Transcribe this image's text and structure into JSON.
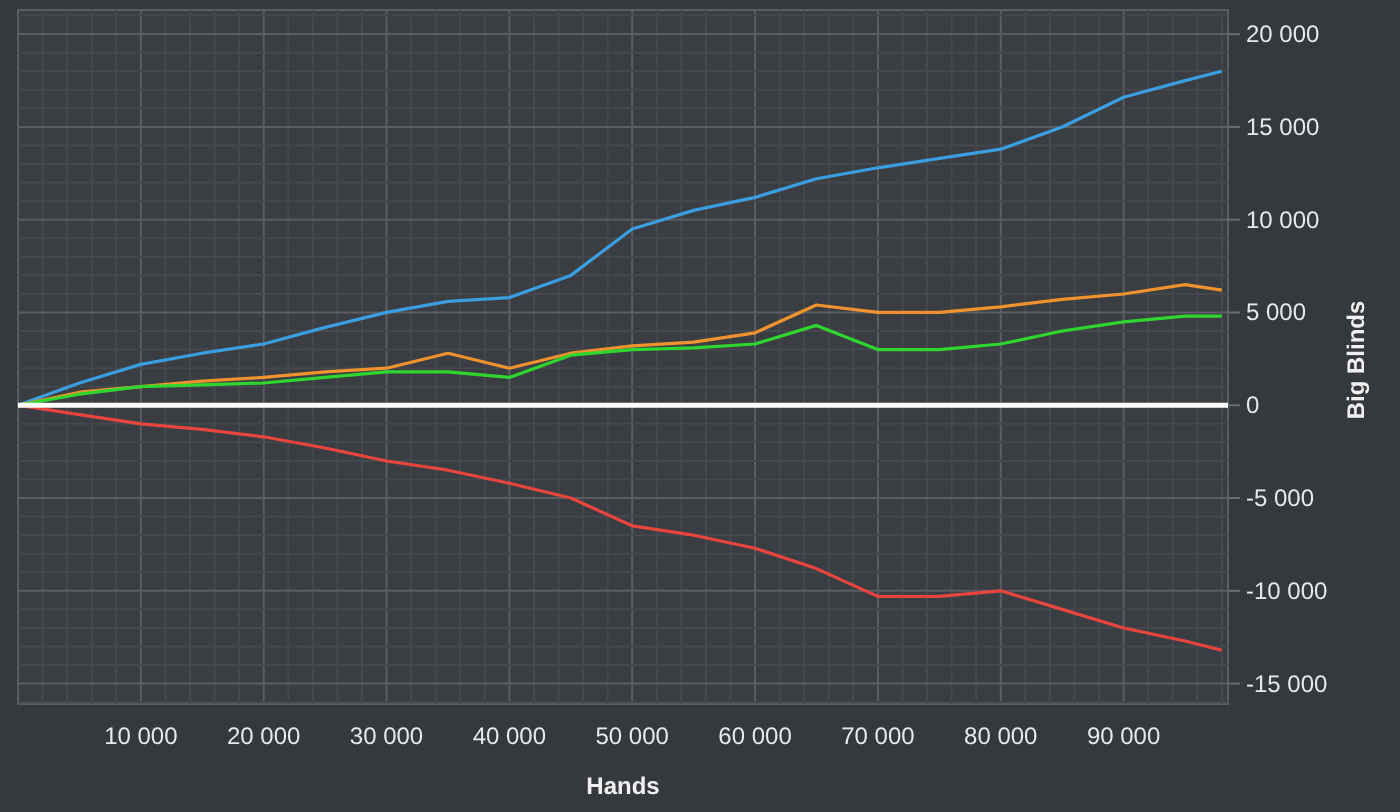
{
  "chart": {
    "chart_data": {
      "type": "line",
      "xlabel": "Hands",
      "ylabel": "Big Blinds",
      "x": [
        0,
        5000,
        10000,
        15000,
        20000,
        25000,
        30000,
        35000,
        40000,
        45000,
        50000,
        55000,
        60000,
        65000,
        70000,
        75000,
        80000,
        85000,
        90000,
        95000,
        98000
      ],
      "series": [
        {
          "color": "#3a9ee0",
          "values": [
            0,
            1200,
            2200,
            2800,
            3300,
            4200,
            5000,
            5600,
            5800,
            7000,
            9500,
            10500,
            11200,
            12200,
            12800,
            13300,
            13800,
            15000,
            16600,
            17500,
            18000
          ]
        },
        {
          "color": "#f0922e",
          "values": [
            0,
            700,
            1000,
            1300,
            1500,
            1800,
            2000,
            2800,
            2000,
            2800,
            3200,
            3400,
            3900,
            5400,
            5000,
            5000,
            5300,
            5700,
            6000,
            6500,
            6200
          ]
        },
        {
          "color": "#2fd62f",
          "values": [
            0,
            600,
            1000,
            1100,
            1200,
            1500,
            1800,
            1800,
            1500,
            2700,
            3000,
            3100,
            3300,
            4300,
            3000,
            3000,
            3300,
            4000,
            4500,
            4800,
            4800
          ]
        },
        {
          "color": "#e8453f",
          "values": [
            0,
            -500,
            -1000,
            -1300,
            -1700,
            -2300,
            -3000,
            -3500,
            -4200,
            -5000,
            -6500,
            -7000,
            -7700,
            -8800,
            -10300,
            -10300,
            -10000,
            -11000,
            -12000,
            -12700,
            -13200
          ]
        }
      ],
      "grid": true,
      "xlim": [
        0,
        98500
      ],
      "ylim": [
        -16100,
        21300
      ],
      "xticks": [
        {
          "value": 10000,
          "label": "10 000"
        },
        {
          "value": 20000,
          "label": "20 000"
        },
        {
          "value": 30000,
          "label": "30 000"
        },
        {
          "value": 40000,
          "label": "40 000"
        },
        {
          "value": 50000,
          "label": "50 000"
        },
        {
          "value": 60000,
          "label": "60 000"
        },
        {
          "value": 70000,
          "label": "70 000"
        },
        {
          "value": 80000,
          "label": "80 000"
        },
        {
          "value": 90000,
          "label": "90 000"
        }
      ],
      "yticks": [
        {
          "value": 20000,
          "label": "20 000"
        },
        {
          "value": 15000,
          "label": "15 000"
        },
        {
          "value": 10000,
          "label": "10 000"
        },
        {
          "value": 5000,
          "label": "5 000"
        },
        {
          "value": 0,
          "label": "0"
        },
        {
          "value": -5000,
          "label": "-5 000"
        },
        {
          "value": -10000,
          "label": "-10 000"
        },
        {
          "value": -15000,
          "label": "-15 000"
        }
      ]
    }
  }
}
